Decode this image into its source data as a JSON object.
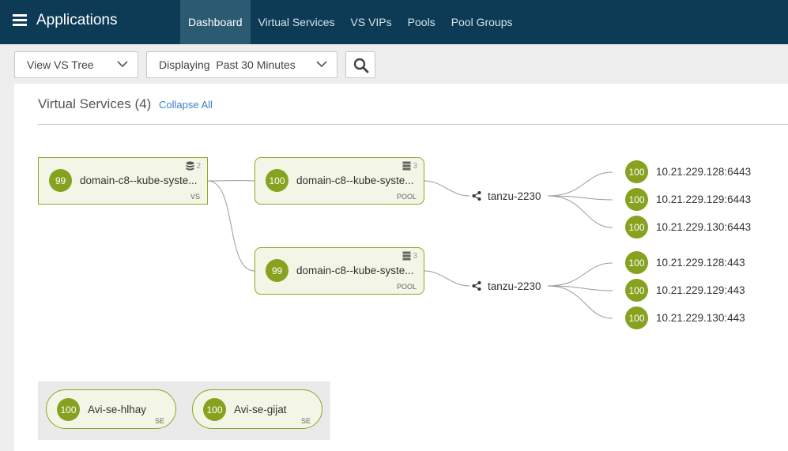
{
  "header": {
    "title": "Applications",
    "tabs": [
      {
        "label": "Dashboard",
        "active": true
      },
      {
        "label": "Virtual Services",
        "active": false
      },
      {
        "label": "VS VIPs",
        "active": false
      },
      {
        "label": "Pools",
        "active": false
      },
      {
        "label": "Pool Groups",
        "active": false
      }
    ]
  },
  "toolbar": {
    "view_select": "View VS Tree",
    "time_select": "Displaying  Past 30 Minutes",
    "search_icon": "search-icon"
  },
  "panel": {
    "heading": "Virtual Services (4)",
    "collapse_label": "Collapse All"
  },
  "tree": {
    "vs": {
      "score": "99",
      "name": "domain-c8--kube-syste...",
      "type": "VS",
      "count": "2"
    },
    "pools": [
      {
        "score": "100",
        "name": "domain-c8--kube-syste...",
        "type": "POOL",
        "count": "3"
      },
      {
        "score": "99",
        "name": "domain-c8--kube-syste...",
        "type": "POOL",
        "count": "3"
      }
    ],
    "networks": [
      "tanzu-2230",
      "tanzu-2230"
    ],
    "servers": [
      {
        "score": "100",
        "label": "10.21.229.128:6443"
      },
      {
        "score": "100",
        "label": "10.21.229.129:6443"
      },
      {
        "score": "100",
        "label": "10.21.229.130:6443"
      },
      {
        "score": "100",
        "label": "10.21.229.128:443"
      },
      {
        "score": "100",
        "label": "10.21.229.129:443"
      },
      {
        "score": "100",
        "label": "10.21.229.130:443"
      }
    ]
  },
  "service_engines": [
    {
      "score": "100",
      "name": "Avi-se-hlhay",
      "type": "SE"
    },
    {
      "score": "100",
      "name": "Avi-se-gijat",
      "type": "SE"
    }
  ],
  "colors": {
    "header_bg": "#0d3b55",
    "active_tab_bg": "#2b5a73",
    "health_green": "#86a21f",
    "node_bg": "#f3f5e6",
    "link": "#3f7fbf"
  }
}
